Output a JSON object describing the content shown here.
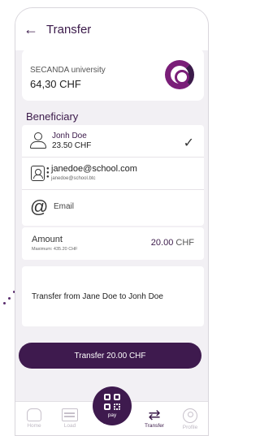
{
  "header": {
    "title": "Transfer"
  },
  "wallet": {
    "name": "SECANDA university",
    "balance": "64,30 CHF"
  },
  "beneficiary": {
    "section_label": "Beneficiary",
    "selected": {
      "name": "Jonh Doe",
      "amount": "23.50 CHF"
    },
    "contact": {
      "email": "janedoe@school.com",
      "sub": "janedoe@school.btc"
    },
    "email_option": {
      "label": "Email"
    }
  },
  "amount": {
    "label": "Amount",
    "max": "Maximum: 435.20 CHF",
    "value": "20.00",
    "currency": "CHF"
  },
  "message": {
    "text": "Transfer from Jane Doe to Jonh Doe"
  },
  "submit": {
    "label": "Transfer 20.00 CHF"
  },
  "tabs": [
    {
      "label": "Home",
      "icon": "home-icon",
      "active": false
    },
    {
      "label": "Load",
      "icon": "wallet-icon",
      "active": false
    },
    {
      "label": "pay",
      "icon": "qr-code-icon",
      "active": false
    },
    {
      "label": "Transfer",
      "icon": "transfer-arrows-icon",
      "active": true
    },
    {
      "label": "Profile",
      "icon": "profile-icon",
      "active": false
    }
  ],
  "colors": {
    "brand": "#3e1a4e",
    "accent": "#7a1e78"
  }
}
